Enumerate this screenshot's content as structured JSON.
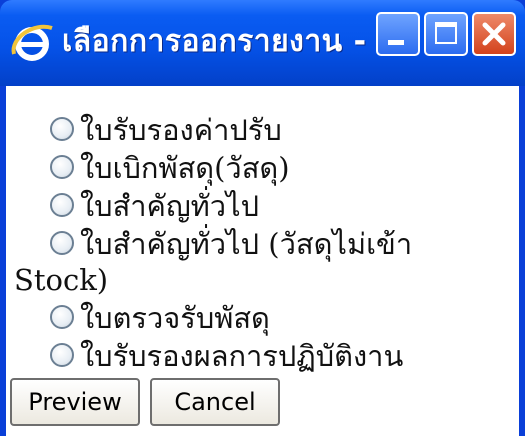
{
  "window": {
    "title": "เลือกการออกรายงาน - ...",
    "controls": {
      "minimize": "minimize-icon",
      "maximize": "maximize-icon",
      "close": "close-icon"
    }
  },
  "options": [
    {
      "label": "ใบรับรองค่าปรับ"
    },
    {
      "label": "ใบเบิกพัสดุ(วัสดุ)"
    },
    {
      "label": "ใบสำคัญทั่วไป"
    },
    {
      "label": "ใบสำคัญทั่วไป (วัสดุไม่เข้า"
    },
    {
      "label": "ใบตรวจรับพัสดุ"
    },
    {
      "label": "ใบรับรองผลการปฏิบัติงาน"
    }
  ],
  "option4_wrap": "Stock)",
  "buttons": {
    "preview": "Preview",
    "cancel": "Cancel"
  },
  "colors": {
    "titlebar": "#0552e8",
    "close": "#d3421c"
  }
}
